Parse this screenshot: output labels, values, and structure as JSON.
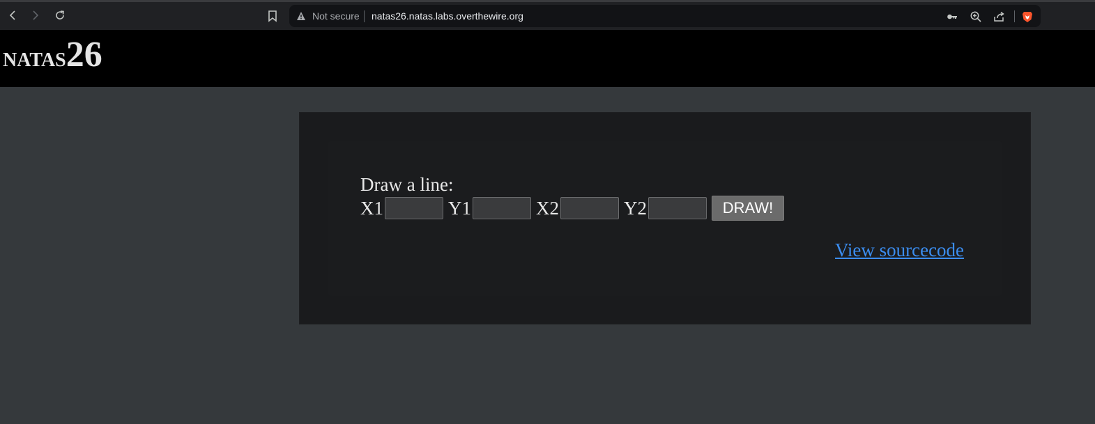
{
  "browser": {
    "security_label": "Not secure",
    "url": "natas26.natas.labs.overthewire.org",
    "icons": [
      "back-icon",
      "forward-icon",
      "reload-icon",
      "bookmark-icon",
      "warning-icon",
      "key-icon",
      "zoom-icon",
      "share-icon",
      "brave-shield-icon"
    ]
  },
  "header": {
    "title_prefix": "natas",
    "title_number": "26"
  },
  "form": {
    "prompt": "Draw a line:",
    "x1_label": "X1",
    "y1_label": "Y1",
    "x2_label": "X2",
    "y2_label": "Y2",
    "x1_value": "",
    "y1_value": "",
    "x2_value": "",
    "y2_value": "",
    "submit_label": "DRAW!"
  },
  "links": {
    "view_source": "View sourcecode"
  },
  "colors": {
    "page_background": "#35393c",
    "header_background": "#000000",
    "content_background": "#1a1b1d",
    "link": "#3b8df0",
    "brave_accent": "#fb542b"
  }
}
